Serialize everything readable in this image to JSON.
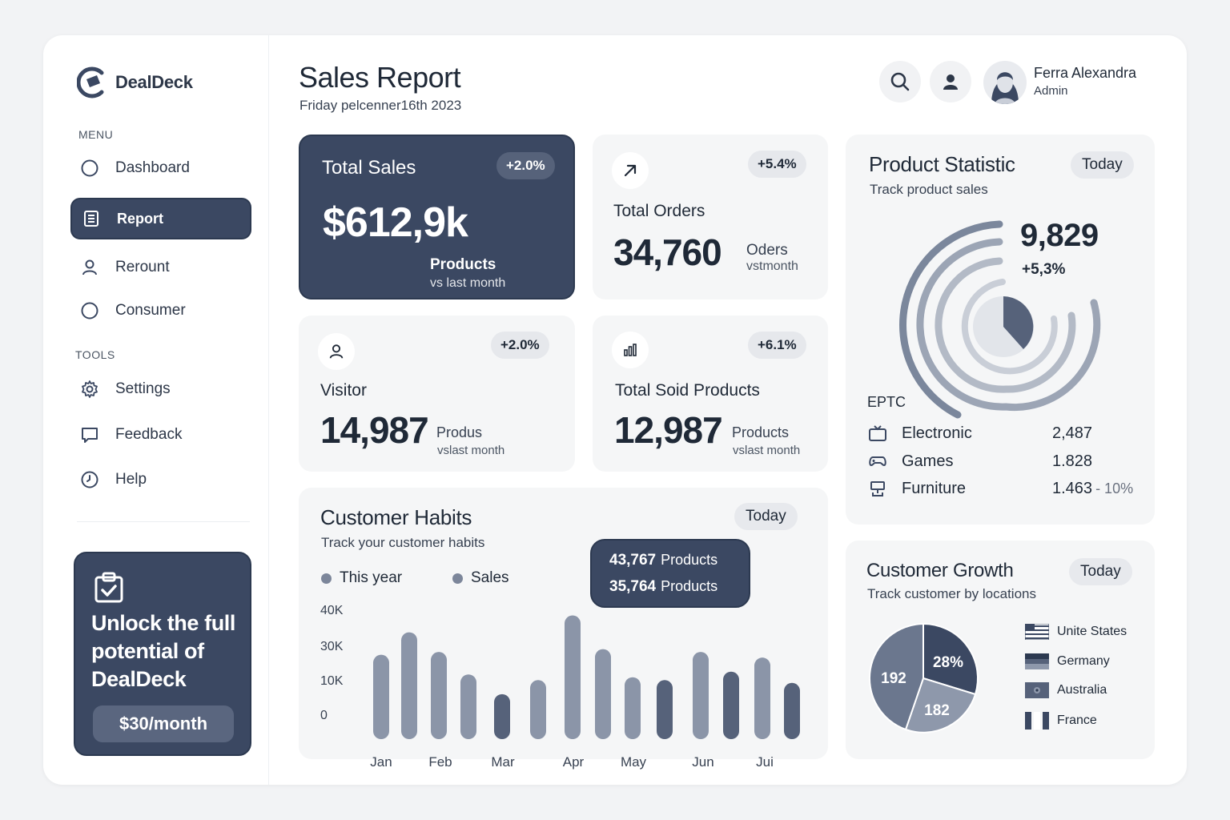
{
  "brand": {
    "name": "DealDeck"
  },
  "sidebar": {
    "menu_label": "MENU",
    "tools_label": "TOOLS",
    "menu_items": [
      {
        "label": "Dashboard",
        "icon": "circle-icon"
      },
      {
        "label": "Report",
        "icon": "report-icon",
        "active": true
      },
      {
        "label": "Rerount",
        "icon": "user-icon"
      },
      {
        "label": "Consumer",
        "icon": "circle-icon"
      }
    ],
    "tool_items": [
      {
        "label": "Settings",
        "icon": "gear-icon"
      },
      {
        "label": "Feedback",
        "icon": "feedback-icon"
      },
      {
        "label": "Help",
        "icon": "clock-icon"
      }
    ],
    "promo": {
      "title": "Unlock the full potential of DealDeck",
      "price": "$30/month"
    }
  },
  "header": {
    "title": "Sales Report",
    "date": "Friday pelcenner16th 2023",
    "user": {
      "name": "Ferra Alexandra",
      "role": "Admin"
    }
  },
  "stats": {
    "total_sales": {
      "label": "Total Sales",
      "badge": "+2.0%",
      "value": "$612,9k",
      "sub1": "Products",
      "sub2": "vs last month"
    },
    "total_orders": {
      "label": "Total Orders",
      "badge": "+5.4%",
      "value": "34,760",
      "sub1": "Oders",
      "sub2": "vstmonth"
    },
    "visitor": {
      "label": "Visitor",
      "badge": "+2.0%",
      "value": "14,987",
      "sub1": "Produs",
      "sub2": "vslast month"
    },
    "sold_products": {
      "label": "Total Soid Products",
      "badge": "+6.1%",
      "value": "12,987",
      "sub1": "Products",
      "sub2": "vslast month"
    }
  },
  "customer_habits": {
    "title": "Customer Habits",
    "subtitle": "Track your customer habits",
    "pill": "Today",
    "legend": [
      "This year",
      "Sales"
    ],
    "tooltip": [
      {
        "value": "43,767",
        "unit": "Products"
      },
      {
        "value": "35,764",
        "unit": "Products"
      }
    ]
  },
  "chart_data": {
    "type": "bar",
    "y_ticks": [
      "40K",
      "30K",
      "10K",
      "0"
    ],
    "x_labels": [
      "Jan",
      "Feb",
      "Mar",
      "Apr",
      "May",
      "Jun",
      "Jui"
    ],
    "ylim": [
      0,
      45
    ],
    "bars": [
      {
        "value": 30,
        "shade": "light"
      },
      {
        "value": 38,
        "shade": "light"
      },
      {
        "value": 31,
        "shade": "light"
      },
      {
        "value": 23,
        "shade": "light"
      },
      {
        "value": 16,
        "shade": "dark"
      },
      {
        "value": 21,
        "shade": "light"
      },
      {
        "value": 44,
        "shade": "light"
      },
      {
        "value": 32,
        "shade": "light"
      },
      {
        "value": 22,
        "shade": "light"
      },
      {
        "value": 21,
        "shade": "dark"
      },
      {
        "value": 31,
        "shade": "light"
      },
      {
        "value": 24,
        "shade": "dark"
      },
      {
        "value": 29,
        "shade": "light"
      },
      {
        "value": 20,
        "shade": "dark"
      }
    ]
  },
  "product_statistic": {
    "title": "Product Statistic",
    "subtitle": "Track product sales",
    "pill": "Today",
    "total": "9,829",
    "change": "+5,3%",
    "label": "EPTC",
    "items": [
      {
        "name": "Electronic",
        "value": "2,487",
        "pct": "",
        "icon": "tv-icon"
      },
      {
        "name": "Games",
        "value": "1.828",
        "pct": "",
        "icon": "gamepad-icon"
      },
      {
        "name": "Furniture",
        "value": "1.463",
        "pct": "- 10%",
        "icon": "chair-icon"
      }
    ]
  },
  "customer_growth": {
    "title": "Customer Growth",
    "subtitle": "Track customer by locations",
    "pill": "Today",
    "pie_labels": [
      "28%",
      "192",
      "182"
    ],
    "countries": [
      {
        "name": "Unite States",
        "icon": "us-flag-icon"
      },
      {
        "name": "Germany",
        "icon": "germany-flag-icon"
      },
      {
        "name": "Australia",
        "icon": "australia-flag-icon"
      },
      {
        "name": "France",
        "icon": "france-flag-icon"
      }
    ]
  },
  "colors": {
    "primary": "#3b4862",
    "bar_light": "#8b95a8",
    "bar_dark": "#56627a",
    "card_bg": "#f5f6f7"
  }
}
